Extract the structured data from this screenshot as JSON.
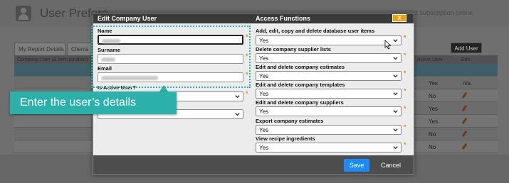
{
  "background": {
    "title": "User Prefere",
    "subnote": "ct subscription online",
    "tabs": [
      "My Report Details",
      "Clients"
    ],
    "add_user_label": "Add User",
    "table": {
      "col_user": "Company User (& item position)",
      "col_active": "Active User",
      "col_edit": "Edit",
      "rows": [
        {
          "active": "",
          "edit": ""
        },
        {
          "active": "Yes",
          "edit": "n/a"
        },
        {
          "active": "No",
          "edit": ""
        },
        {
          "active": "Yes",
          "edit": ""
        },
        {
          "active": "Yes",
          "edit": ""
        },
        {
          "active": "No",
          "edit": ""
        },
        {
          "active": "No",
          "edit": ""
        }
      ]
    }
  },
  "modal": {
    "title": "Edit Company User",
    "access_heading": "Access Functions",
    "close_label": "X",
    "fields": {
      "name_label": "Name",
      "surname_label": "Surname",
      "email_label": "Email",
      "active_label": "Is Active User?"
    },
    "access_functions": [
      {
        "label": "Add, edit, copy and delete database user items",
        "value": "Yes"
      },
      {
        "label": "Delete company supplier lists",
        "value": "Yes"
      },
      {
        "label": "Edit and delete company estimates",
        "value": "Yes"
      },
      {
        "label": "Edit and delete company templates",
        "value": "Yes"
      },
      {
        "label": "Edit and delete company suppliers",
        "value": "Yes"
      },
      {
        "label": "Export company estimates",
        "value": "Yes"
      },
      {
        "label": "View recipe ingredients",
        "value": "Yes"
      }
    ],
    "save_label": "Save",
    "cancel_label": "Cancel"
  },
  "callout": {
    "text": "Enter the user’s details"
  },
  "colors": {
    "accent": "#2bb0aa",
    "save": "#1a8cff",
    "close": "#f0a000",
    "required": "#e89000"
  }
}
